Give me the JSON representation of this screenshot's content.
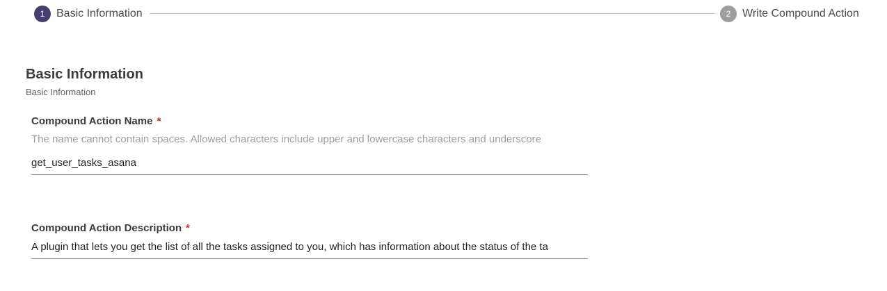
{
  "stepper": {
    "steps": [
      {
        "number": "1",
        "label": "Basic Information"
      },
      {
        "number": "2",
        "label": "Write Compound Action"
      }
    ]
  },
  "section": {
    "title": "Basic Information",
    "subtitle": "Basic Information"
  },
  "form": {
    "name_field": {
      "label": "Compound Action Name",
      "required_mark": "*",
      "hint": "The name cannot contain spaces. Allowed characters include upper and lowercase characters and underscore",
      "value": "get_user_tasks_asana"
    },
    "description_field": {
      "label": "Compound Action Description",
      "required_mark": "*",
      "value": "A plugin that lets you get the list of all the tasks assigned to you, which has information about the status of the ta"
    }
  },
  "colors": {
    "step_active": "#473f6f",
    "step_inactive": "#9e9e9e",
    "required": "#d32f2f"
  }
}
